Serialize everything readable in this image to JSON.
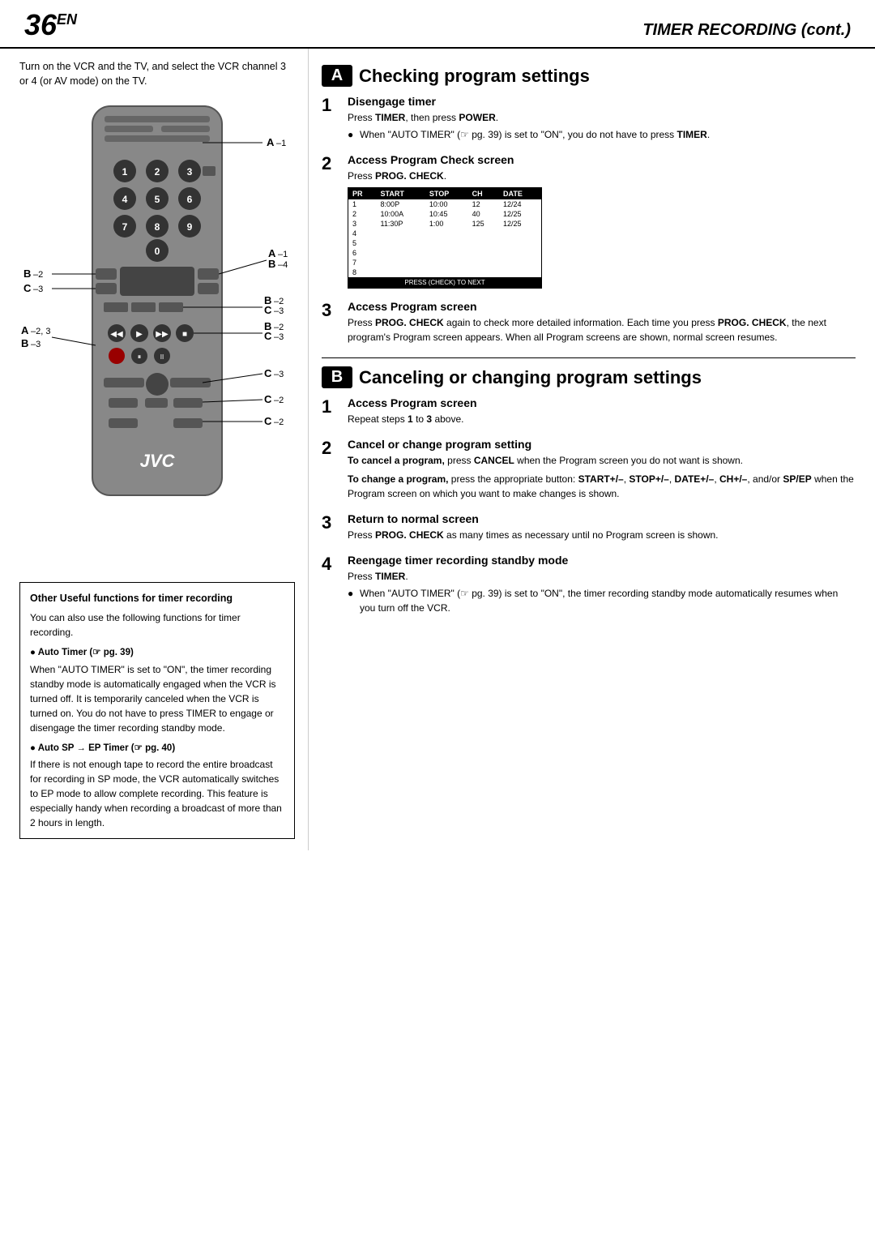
{
  "header": {
    "page_number": "36",
    "superscript": "EN",
    "title": "TIMER RECORDING (cont.)"
  },
  "intro": {
    "text": "Turn on the VCR and the TV, and select the VCR channel 3 or 4 (or AV mode) on the TV."
  },
  "section_a": {
    "badge": "A",
    "title": "Checking program settings",
    "steps": [
      {
        "num": "1",
        "heading": "Disengage timer",
        "lines": [
          "Press TIMER, then press POWER.",
          "When \"AUTO TIMER\" (☞ pg. 39) is set to \"ON\", you do not have to press TIMER."
        ],
        "bullet_index": 1
      },
      {
        "num": "2",
        "heading": "Access Program Check screen",
        "press_text": "Press PROG. CHECK."
      },
      {
        "num": "3",
        "heading": "Access Program screen",
        "lines": [
          "Press PROG. CHECK again to check more detailed information. Each time you press PROG. CHECK, the next program's Program screen appears. When all Program screens are shown, normal screen resumes."
        ]
      }
    ]
  },
  "section_b": {
    "badge": "B",
    "title": "Canceling or changing program settings",
    "steps": [
      {
        "num": "1",
        "heading": "Access Program screen",
        "lines": [
          "Repeat steps 1 to 3 above."
        ]
      },
      {
        "num": "2",
        "heading": "Cancel or change program setting",
        "cancel_text": "To cancel a program, press CANCEL when the Program screen you do not want is shown.",
        "change_text": "To change a program, press the appropriate button: START+/–, STOP+/–, DATE+/–, CH+/–, and/or SP/EP when the Program screen on which you want to make changes is shown."
      },
      {
        "num": "3",
        "heading": "Return to normal screen",
        "lines": [
          "Press PROG. CHECK as many times as necessary until no Program screen is shown."
        ]
      },
      {
        "num": "4",
        "heading": "Reengage timer recording standby mode",
        "press_text": "Press TIMER.",
        "bullet_text": "When \"AUTO TIMER\" (☞ pg. 39) is set to \"ON\", the timer recording standby mode automatically resumes when you turn off the VCR."
      }
    ]
  },
  "prog_table": {
    "headers": [
      "PR",
      "START",
      "STOP",
      "CH",
      "DATE"
    ],
    "rows": [
      [
        "1",
        "8:00P",
        "10:00",
        "12",
        "12/24"
      ],
      [
        "2",
        "10:00A",
        "10:45",
        "40",
        "12/25"
      ],
      [
        "3",
        "11:30P",
        "1:00",
        "125",
        "12/25"
      ],
      [
        "4",
        "",
        "",
        "",
        ""
      ],
      [
        "5",
        "",
        "",
        "",
        ""
      ],
      [
        "6",
        "",
        "",
        "",
        ""
      ],
      [
        "7",
        "",
        "",
        "",
        ""
      ],
      [
        "8",
        "",
        "",
        "",
        ""
      ]
    ],
    "footer": "PRESS (CHECK) TO NEXT"
  },
  "info_box": {
    "title": "Other Useful functions for timer recording",
    "intro": "You can also use the following functions for timer recording.",
    "items": [
      {
        "label": "● Auto Timer (☞ pg. 39)",
        "text": "When \"AUTO TIMER\" is set to \"ON\", the timer recording standby mode is automatically engaged when the VCR is turned off. It is temporarily canceled when the VCR is turned on. You do not have to press TIMER to engage or disengage the timer recording standby mode."
      },
      {
        "label": "● Auto SP → EP Timer (☞ pg. 40)",
        "text": "If there is not enough tape to record the entire broadcast for recording in SP mode, the VCR automatically switches to EP mode to allow complete recording. This feature is especially handy when recording a broadcast of more than 2 hours in length."
      }
    ]
  },
  "remote_labels": {
    "A1": "A –1",
    "B2": "B –2",
    "C3": "C –3",
    "A1b": "A –1",
    "B4": "B –4",
    "B2c": "B –2",
    "C3b": "C –3",
    "A23": "A –2, 3",
    "B2c2": "B –2",
    "C3c": "C –3",
    "B3": "B –3",
    "C3d": "C –3",
    "C2": "C –2",
    "C2b": "C –2"
  }
}
